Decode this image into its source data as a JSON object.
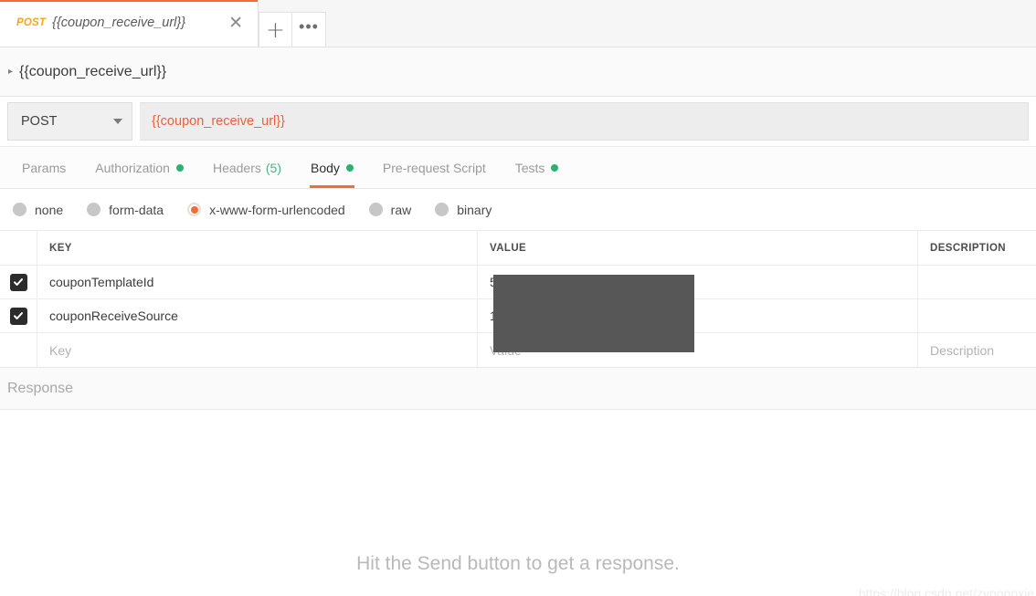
{
  "tabstrip": {
    "request_tab": {
      "method": "POST",
      "title": "{{coupon_receive_url}}",
      "close_icon": "close-icon"
    },
    "new_tab_label": "+",
    "more_label": "•••"
  },
  "breadcrumb": {
    "caret": "▸",
    "label": "{{coupon_receive_url}}"
  },
  "urlbar": {
    "method": "POST",
    "url": "{{coupon_receive_url}}"
  },
  "request_tabs": [
    {
      "label": "Params",
      "active": false,
      "dot": false,
      "count": ""
    },
    {
      "label": "Authorization",
      "active": false,
      "dot": true,
      "count": ""
    },
    {
      "label": "Headers",
      "active": false,
      "dot": false,
      "count": "(5)"
    },
    {
      "label": "Body",
      "active": true,
      "dot": true,
      "count": ""
    },
    {
      "label": "Pre-request Script",
      "active": false,
      "dot": false,
      "count": ""
    },
    {
      "label": "Tests",
      "active": false,
      "dot": true,
      "count": ""
    }
  ],
  "body_types": [
    {
      "label": "none",
      "selected": false
    },
    {
      "label": "form-data",
      "selected": false
    },
    {
      "label": "x-www-form-urlencoded",
      "selected": true
    },
    {
      "label": "raw",
      "selected": false
    },
    {
      "label": "binary",
      "selected": false
    }
  ],
  "table": {
    "headers": {
      "key": "KEY",
      "value": "VALUE",
      "description": "DESCRIPTION"
    },
    "rows": [
      {
        "checked": true,
        "key": "couponTemplateId",
        "value": "5",
        "description": ""
      },
      {
        "checked": true,
        "key": "couponReceiveSource",
        "value": "1",
        "description": ""
      }
    ],
    "placeholder_row": {
      "key": "Key",
      "value": "Value",
      "description": "Description"
    }
  },
  "response": {
    "title": "Response",
    "empty_message": "Hit the Send button to get a response."
  },
  "watermark": "https://blog.csdn.net/zyooooxie",
  "colors": {
    "accent": "#f26b3a",
    "method": "#f5a623",
    "url_text": "#e8613c",
    "dot_green": "#2bb273",
    "redaction": "#575757",
    "checkbox": "#2c2c2c"
  }
}
